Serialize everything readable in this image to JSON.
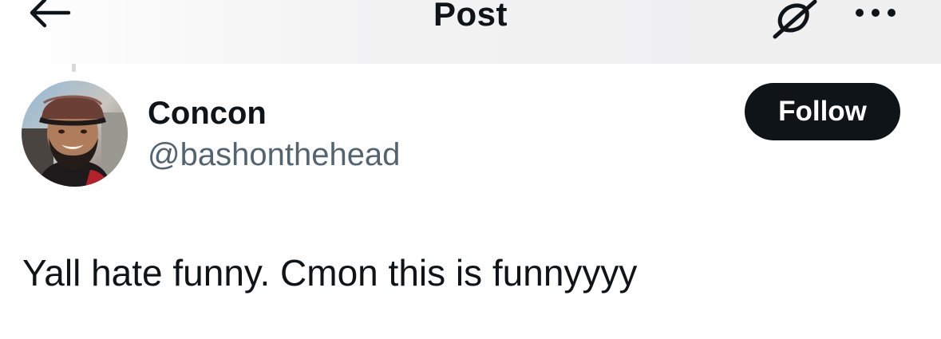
{
  "header": {
    "title": "Post",
    "back_icon": "arrow-left-icon",
    "grok_icon": "grok-icon",
    "more_icon": "more-horizontal-icon"
  },
  "post": {
    "author": {
      "display_name": "Concon",
      "handle": "@bashonthehead",
      "avatar_icon": "avatar-photo"
    },
    "follow_label": "Follow",
    "text": "Yall hate funny. Cmon this is funnyyyy"
  },
  "colors": {
    "text_primary": "#0f1419",
    "text_secondary": "#536471",
    "follow_bg": "#0f1419",
    "follow_text": "#ffffff"
  }
}
